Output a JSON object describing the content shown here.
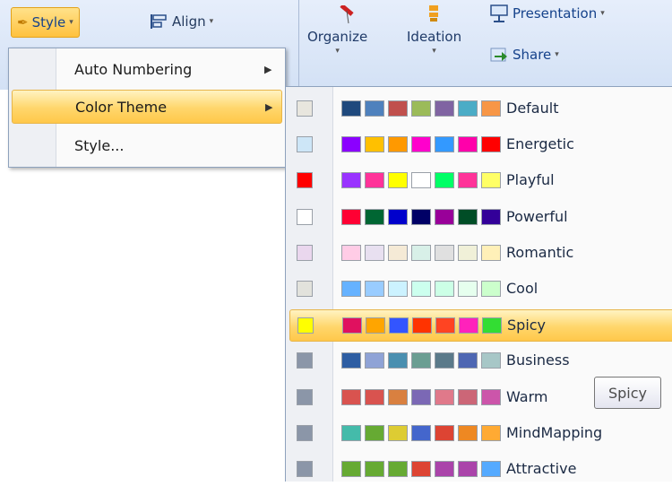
{
  "ribbon": {
    "style_label": "Style",
    "align_label": "Align",
    "organize_label": "Organize",
    "ideation_label": "Ideation",
    "presentation_label": "Presentation",
    "share_label": "Share"
  },
  "style_menu": {
    "items": [
      {
        "label": "Auto Numbering"
      },
      {
        "label": "Color Theme"
      },
      {
        "label": "Style..."
      }
    ]
  },
  "themes": [
    {
      "name": "Default",
      "key": "#e8e6de",
      "colors": [
        "#1f497d",
        "#4f81bd",
        "#c0504d",
        "#9bbb59",
        "#8064a2",
        "#4bacc6",
        "#f79646"
      ]
    },
    {
      "name": "Energetic",
      "key": "#cde6f7",
      "colors": [
        "#8b00ff",
        "#ffc000",
        "#ff9900",
        "#ff00cc",
        "#3399ff",
        "#ff00aa",
        "#ff0000"
      ]
    },
    {
      "name": "Playful",
      "key": "#ff0000",
      "colors": [
        "#9933ff",
        "#ff3399",
        "#ffff00",
        "#ffffff",
        "#00ff66",
        "#ff3399",
        "#ffff66"
      ]
    },
    {
      "name": "Powerful",
      "key": "#ffffff",
      "colors": [
        "#ff0033",
        "#006633",
        "#0000cc",
        "#000066",
        "#990099",
        "#004d26",
        "#330099"
      ]
    },
    {
      "name": "Romantic",
      "key": "#ead7ee",
      "colors": [
        "#ffcce6",
        "#e8e0f0",
        "#f5ead6",
        "#d8f0e8",
        "#e0e0e0",
        "#f0f0d8",
        "#fff0b8"
      ]
    },
    {
      "name": "Cool",
      "key": "#e2e2dc",
      "colors": [
        "#66b2ff",
        "#99ccff",
        "#ccf2ff",
        "#ccffee",
        "#ccffe6",
        "#e6ffee",
        "#ccffcc"
      ]
    },
    {
      "name": "Spicy",
      "key": "#ffff00",
      "colors": [
        "#e0115f",
        "#ffa500",
        "#3355ff",
        "#ff3300",
        "#ff4422",
        "#ff22bb",
        "#33dd33"
      ]
    },
    {
      "name": "Business",
      "key": "#8b96a8",
      "colors": [
        "#2e5ea3",
        "#8fa3d6",
        "#4a8fb0",
        "#6b9e93",
        "#5b7a8a",
        "#4e67b3",
        "#a7c7c7"
      ]
    },
    {
      "name": "Warm",
      "key": "#8b96a8",
      "colors": [
        "#d9534f",
        "#d9534f",
        "#d98040",
        "#7b68b5",
        "#e0798a",
        "#cc6677",
        "#cc55aa"
      ]
    },
    {
      "name": "MindMapping",
      "key": "#8b96a8",
      "colors": [
        "#44bbaa",
        "#66aa33",
        "#ddcc33",
        "#4466cc",
        "#dd4433",
        "#ee8822",
        "#ffaa33"
      ]
    },
    {
      "name": "Attractive",
      "key": "#8b96a8",
      "colors": [
        "#66aa33",
        "#66aa33",
        "#66aa33",
        "#dd4433",
        "#aa44aa",
        "#aa44aa",
        "#55aaff"
      ]
    }
  ],
  "tooltip": "Spicy"
}
